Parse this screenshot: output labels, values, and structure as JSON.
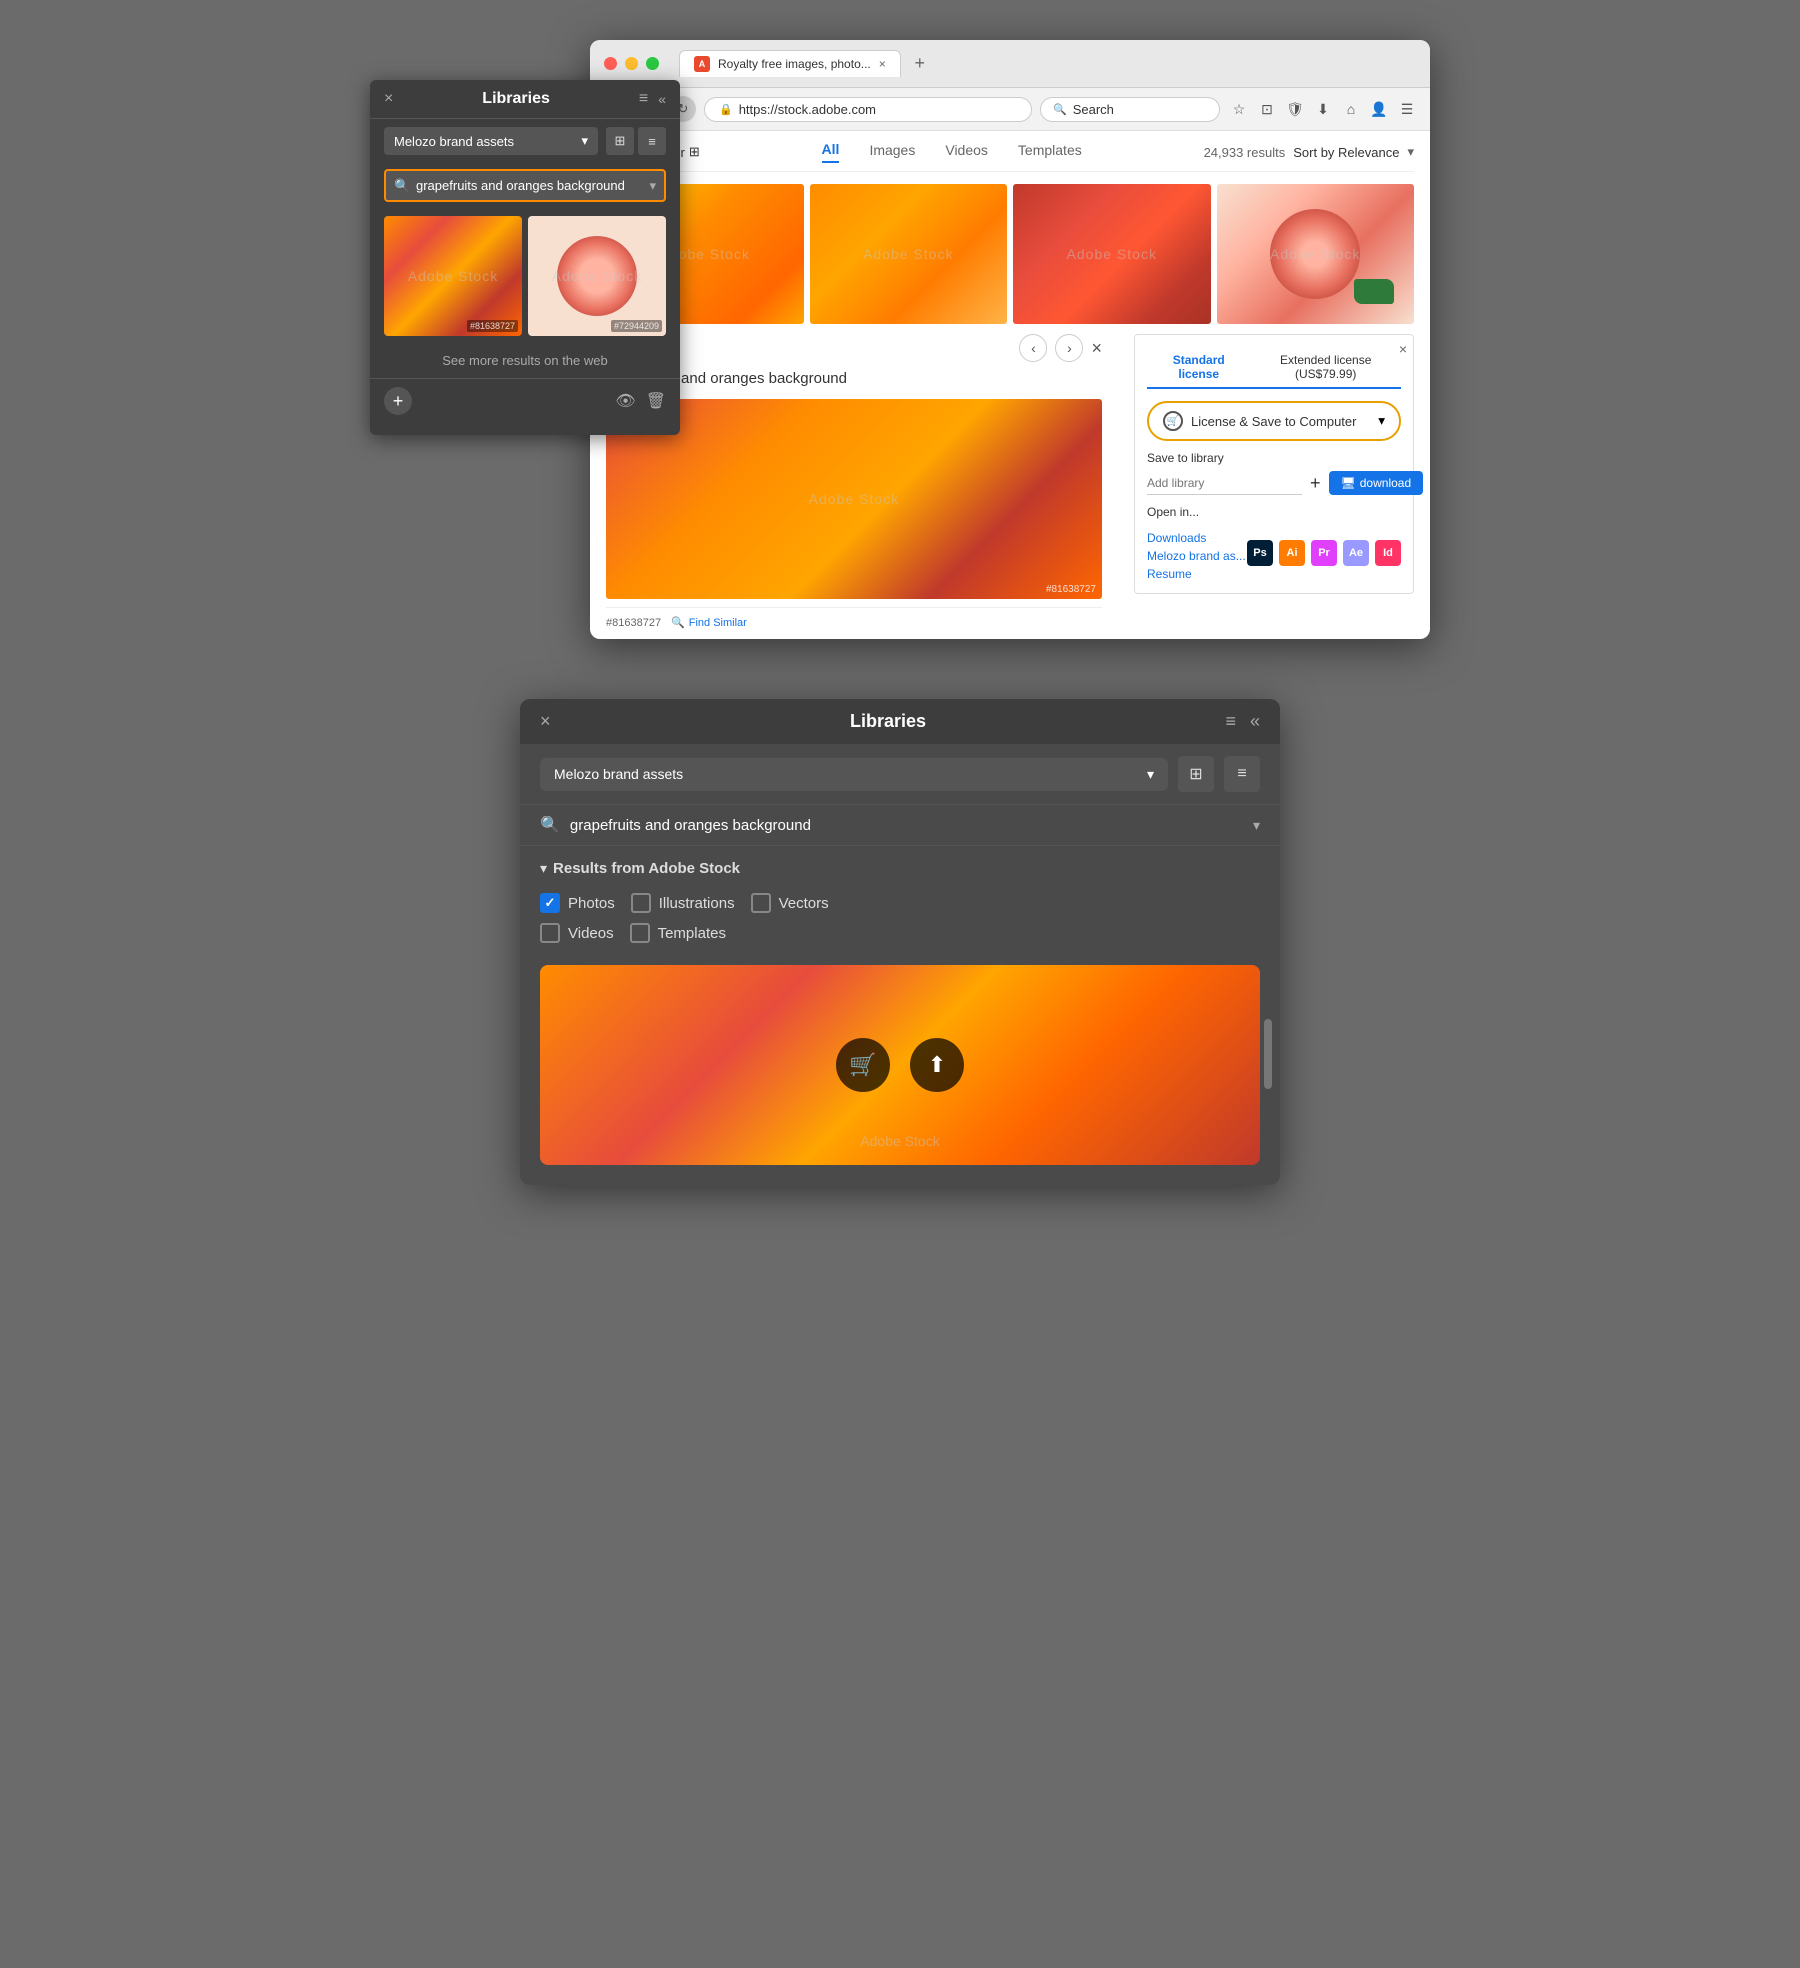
{
  "top": {
    "browser": {
      "tab_title": "Royalty free images, photo...",
      "add_tab": "+",
      "url": "https://stock.adobe.com",
      "search_placeholder": "Search",
      "nav": {
        "back": "‹",
        "forward": "›",
        "refresh": "↻"
      },
      "actions": [
        "☆",
        "⊡",
        "🛡",
        "⬇",
        "⌂",
        "👤",
        "☰"
      ]
    },
    "stock": {
      "filter_label": "Filter",
      "tabs": [
        "All",
        "Images",
        "Videos",
        "Templates"
      ],
      "active_tab": "All",
      "results_count": "24,933 results",
      "sort_label": "Sort by Relevance",
      "image_title": "grapefruits and oranges background",
      "image_id": "#81638727",
      "image_id2": "#72944209",
      "find_similar": "Find Similar",
      "license": {
        "standard_label": "Standard license",
        "extended_label": "Extended license (US$79.99)",
        "btn_label": "License & Save to Computer",
        "btn_chevron": "▾",
        "save_library_label": "Save to library",
        "add_library_placeholder": "Add library",
        "download_label": "download",
        "open_in_label": "Open in...",
        "library_links": [
          "Downloads",
          "Melozo brand as...",
          "Resume"
        ],
        "close": "×"
      }
    },
    "panel": {
      "title": "Libraries",
      "close": "×",
      "collapse": "«",
      "menu": "≡",
      "library_name": "Melozo brand assets",
      "library_chevron": "▾",
      "view_grid": "⊞",
      "view_list": "≡",
      "search_text": "grapefruits and oranges background",
      "image1_id": "#81638727",
      "image2_id": "#72944209",
      "see_more": "See more results on the web",
      "add": "+",
      "footer_icons": [
        "👁",
        "🗑"
      ]
    }
  },
  "bottom": {
    "header": {
      "close": "×",
      "collapse": "«",
      "title": "Libraries",
      "menu": "≡"
    },
    "library": {
      "name": "Melozo brand assets",
      "chevron": "▾",
      "view_grid": "⊞",
      "view_list": "≡"
    },
    "search": {
      "icon": "🔍",
      "text": "grapefruits and oranges background",
      "chevron": "▾"
    },
    "results": {
      "chevron": "▾",
      "title": "Results from Adobe Stock",
      "scrollbar": true
    },
    "filters": {
      "photos": {
        "label": "Photos",
        "checked": true
      },
      "illustrations": {
        "label": "Illustrations",
        "checked": false
      },
      "vectors": {
        "label": "Vectors",
        "checked": false
      },
      "videos": {
        "label": "Videos",
        "checked": false
      },
      "templates": {
        "label": "Templates",
        "checked": false
      }
    },
    "image": {
      "watermark": "Adobe Stock",
      "action1": "🛒",
      "action2": "⬆"
    }
  }
}
